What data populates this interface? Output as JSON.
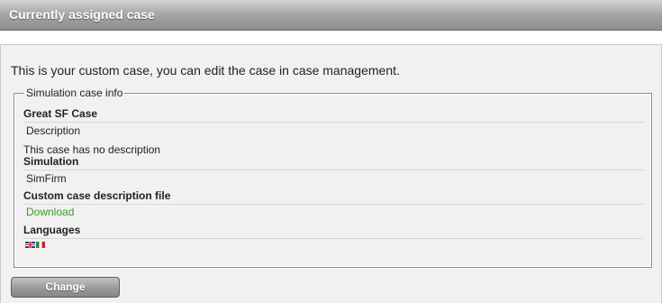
{
  "header": {
    "title": "Currently assigned case"
  },
  "main": {
    "intro_text": "This is your custom case, you can edit the case in case management.",
    "fieldset": {
      "legend": "Simulation case info",
      "case_name": "Great SF Case",
      "description_label": "Description",
      "description_text": "This case has no description",
      "simulation_label": "Simulation",
      "simulation_value": "SimFirm",
      "custom_file_label": "Custom case description file",
      "download_link": "Download",
      "languages_label": "Languages",
      "languages": [
        {
          "icon": "uk-flag-icon"
        },
        {
          "icon": "italy-flag-icon"
        }
      ]
    },
    "change_button": "Change"
  },
  "colors": {
    "title_text": "#ffffff",
    "link_green": "#3a9a2a",
    "panel_background": "#f1f1f1",
    "button_gray": "#9a9a9a"
  }
}
